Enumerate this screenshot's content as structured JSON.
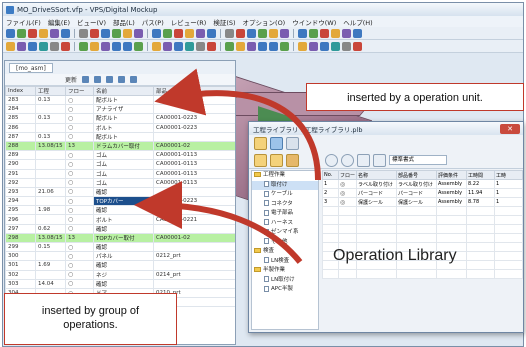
{
  "window": {
    "title": "MO_DriveSSort.vfp - VPS/Digital Mockup",
    "menu": [
      "ファイル(F)",
      "編集(E)",
      "ビュー(V)",
      "部品(L)",
      "パス(P)",
      "レビュー(R)",
      "検証(S)",
      "オプション(O)",
      "ウインドウ(W)",
      "ヘルプ(H)"
    ]
  },
  "left_panel": {
    "tab": "[mo_asm]",
    "toolbar_label": "更新",
    "columns": [
      "Index",
      "工程",
      "フロー",
      "名前",
      "部品"
    ],
    "rows": [
      {
        "index": "283",
        "step": "0.13",
        "flow": "",
        "name": "配ボルト",
        "part": "",
        "green": false
      },
      {
        "index": "284",
        "step": "",
        "flow": "",
        "name": "アナライザ",
        "part": "",
        "green": false
      },
      {
        "index": "285",
        "step": "0.13",
        "flow": "",
        "name": "配ボルト",
        "part": "CA00001-0223",
        "green": false
      },
      {
        "index": "286",
        "step": "",
        "flow": "",
        "name": "ボルト",
        "part": "CA00001-0223",
        "green": false
      },
      {
        "index": "287",
        "step": "0.13",
        "flow": "",
        "name": "配ボルト",
        "part": "",
        "green": false
      },
      {
        "index": "288",
        "step": "13.08/15",
        "flow": "13",
        "name": "ドラムカバー取付",
        "part": "CA00001-02",
        "green": true
      },
      {
        "index": "289",
        "step": "",
        "flow": "",
        "name": "ゴム",
        "part": "CA00001-0113",
        "green": false
      },
      {
        "index": "290",
        "step": "",
        "flow": "",
        "name": "ゴム",
        "part": "CA00001-0113",
        "green": false
      },
      {
        "index": "291",
        "step": "",
        "flow": "",
        "name": "ゴム",
        "part": "CA00001-0113",
        "green": false
      },
      {
        "index": "292",
        "step": "",
        "flow": "",
        "name": "ゴム",
        "part": "CA00001-0113",
        "green": false
      },
      {
        "index": "293",
        "step": "21.06",
        "flow": "",
        "name": "確認",
        "part": "",
        "green": false
      },
      {
        "index": "294",
        "step": "",
        "flow": "",
        "name": "TOPカバー",
        "part": "CA00001-0223",
        "green": false,
        "selected": true
      },
      {
        "index": "295",
        "step": "1.98",
        "flow": "",
        "name": "確認",
        "part": "",
        "green": false
      },
      {
        "index": "296",
        "step": "",
        "flow": "",
        "name": "ボルト",
        "part": "CA00001-0221",
        "green": false
      },
      {
        "index": "297",
        "step": "0.62",
        "flow": "",
        "name": "確認",
        "part": "",
        "green": false
      },
      {
        "index": "298",
        "step": "13.08/15",
        "flow": "13",
        "name": "TOPカバー取付",
        "part": "CA00001-02",
        "green": true
      },
      {
        "index": "299",
        "step": "0.15",
        "flow": "",
        "name": "確認",
        "part": "",
        "green": false
      },
      {
        "index": "300",
        "step": "",
        "flow": "",
        "name": "パネル",
        "part": "0212_prt",
        "green": false
      },
      {
        "index": "301",
        "step": "1.69",
        "flow": "",
        "name": "確認",
        "part": "",
        "green": false
      },
      {
        "index": "302",
        "step": "",
        "flow": "",
        "name": "ネジ",
        "part": "0214_prt",
        "green": false
      },
      {
        "index": "303",
        "step": "14.04",
        "flow": "",
        "name": "確認",
        "part": "",
        "green": false
      },
      {
        "index": "304",
        "step": "",
        "flow": "",
        "name": "ドア",
        "part": "0210_prt",
        "green": false
      },
      {
        "index": "305",
        "step": "3.03",
        "flow": "",
        "name": "確認",
        "part": "",
        "green": false
      }
    ]
  },
  "library": {
    "title": "工程ライブラリ : 工程ライブラリ.plb",
    "dropdown": "標準書式",
    "tree": [
      {
        "label": "工程作業",
        "type": "folder",
        "level": 0
      },
      {
        "label": "取付け",
        "type": "doc",
        "level": 1,
        "highlight": true
      },
      {
        "label": "ケーブル",
        "type": "doc",
        "level": 1
      },
      {
        "label": "コネクタ",
        "type": "doc",
        "level": 1
      },
      {
        "label": "電子部品",
        "type": "doc",
        "level": 1
      },
      {
        "label": "ハーネス",
        "type": "doc",
        "level": 1
      },
      {
        "label": "ゼンマイ系",
        "type": "doc",
        "level": 1
      },
      {
        "label": "その他",
        "type": "doc",
        "level": 1
      },
      {
        "label": "検査",
        "type": "folder",
        "level": 0
      },
      {
        "label": "LN検査",
        "type": "doc",
        "level": 1
      },
      {
        "label": "半製作業",
        "type": "folder",
        "level": 0
      },
      {
        "label": "LN取付け",
        "type": "doc",
        "level": 1
      },
      {
        "label": "APC半製",
        "type": "doc",
        "level": 1
      }
    ],
    "columns": [
      "No.",
      "フロー",
      "名称",
      "部品番号",
      "評価条件",
      "工時間",
      "工時"
    ],
    "rows": [
      {
        "no": "1",
        "name": "ラベル取り付け",
        "part": "ラベル取り付け",
        "cond": "Assembly",
        "t1": "8.22",
        "t2": "1"
      },
      {
        "no": "2",
        "name": "パーコード",
        "part": "パーコード",
        "cond": "Assembly",
        "t1": "11.94",
        "t2": "1"
      },
      {
        "no": "3",
        "name": "保護シール",
        "part": "保護シール",
        "cond": "Assembly",
        "t1": "8.78",
        "t2": "1"
      }
    ],
    "caption": "Operation Library"
  },
  "callouts": {
    "top": "inserted by a operation unit.",
    "bottom_line1": "inserted by group of",
    "bottom_line2": "operations."
  },
  "colors": {
    "arrow": "#c0392b",
    "green_row": "#b8f0a2",
    "selected": "#1d4f8c"
  }
}
